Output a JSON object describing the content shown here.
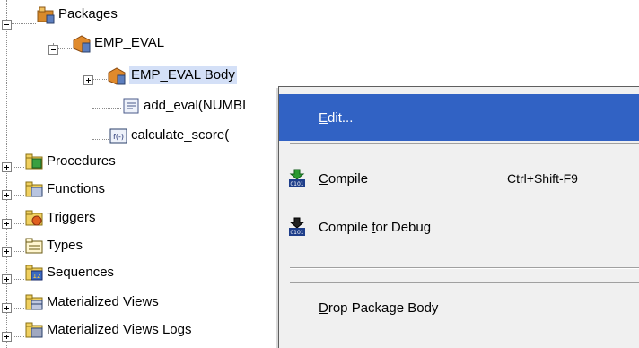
{
  "tree": {
    "items": [
      {
        "label": "Packages",
        "expanded": true
      },
      {
        "label": "EMP_EVAL",
        "expanded": true
      },
      {
        "label": "EMP_EVAL Body",
        "expanded": false
      },
      {
        "label": "add_eval(NUMBI"
      },
      {
        "label": "calculate_score("
      },
      {
        "label": "Procedures",
        "expanded": false
      },
      {
        "label": "Functions",
        "expanded": false
      },
      {
        "label": "Triggers",
        "expanded": false
      },
      {
        "label": "Types",
        "expanded": false
      },
      {
        "label": "Sequences",
        "expanded": false
      },
      {
        "label": "Materialized Views",
        "expanded": false
      },
      {
        "label": "Materialized Views Logs",
        "expanded": false
      }
    ],
    "function_icon_text": "f(-)",
    "sequence_icon_text": "12"
  },
  "context_menu": {
    "items": [
      {
        "label": "Edit...",
        "mnemonic": "E",
        "rest": "dit...",
        "shortcut": ""
      },
      {
        "label": "Compile",
        "mnemonic": "C",
        "rest": "ompile",
        "shortcut": "Ctrl+Shift-F9",
        "icon": "compile-icon"
      },
      {
        "label": "Compile for Debug",
        "pre": "Compile ",
        "mnemonic": "f",
        "rest": "or Debug",
        "icon": "compile-debug-icon"
      },
      {
        "label": "Drop Package Body",
        "mnemonic": "D",
        "rest": "rop Package Body"
      }
    ],
    "icon_text": "0101",
    "highlight_color": "#3162c4"
  }
}
